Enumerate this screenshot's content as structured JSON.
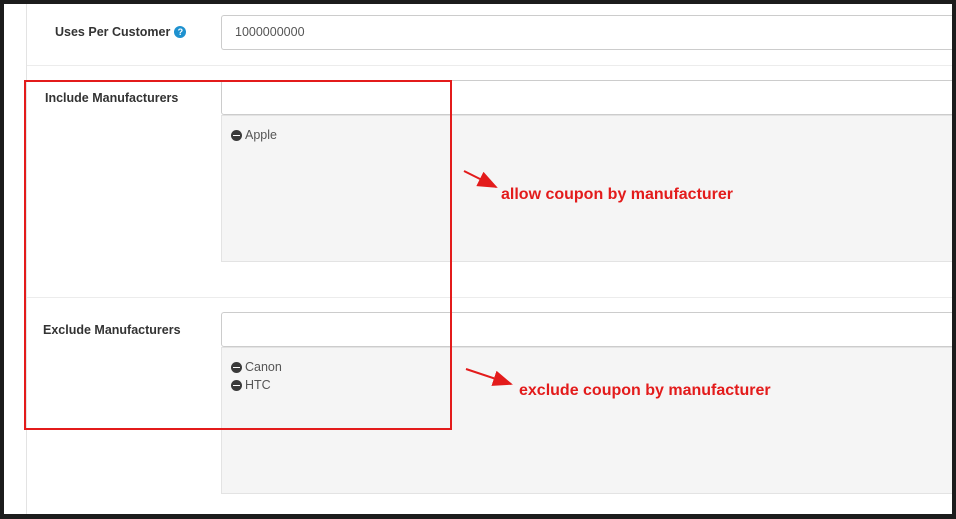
{
  "uses_per_customer": {
    "label": "Uses Per Customer",
    "help_icon": "?",
    "value": "1000000000"
  },
  "include_manufacturers": {
    "label": "Include Manufacturers",
    "input_value": "",
    "items": [
      "Apple"
    ]
  },
  "exclude_manufacturers": {
    "label": "Exclude Manufacturers",
    "input_value": "",
    "items": [
      "Canon",
      "HTC"
    ]
  },
  "annotations": {
    "allow": "allow coupon by manufacturer",
    "exclude": "exclude coupon by manufacturer",
    "color": "#e31b1b"
  },
  "icons": {
    "help": "question-circle-icon",
    "remove": "minus-circle-icon"
  }
}
